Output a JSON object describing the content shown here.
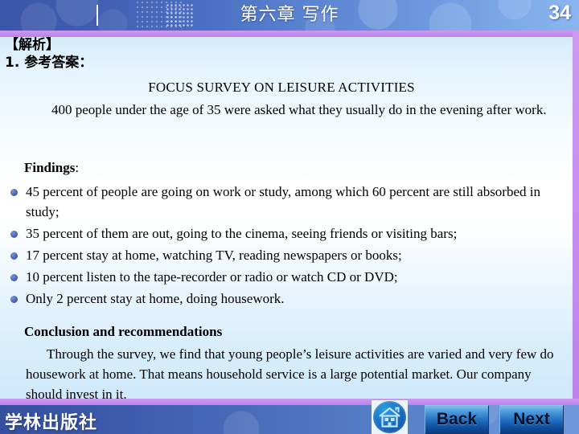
{
  "header": {
    "title": "第六章  写作",
    "page_number": "34"
  },
  "content": {
    "analysis_label": "【解析】",
    "answer_label": "1. 参考答案：",
    "doc_title": "FOCUS SURVEY ON LEISURE ACTIVITIES",
    "intro": "400 people under the age of 35 were asked what they usually do in the evening after work.",
    "findings_label": "Findings",
    "findings_label_suffix": ":",
    "findings": [
      "45 percent of people are going on work or study, among which 60 percent are still absorbed in study;",
      "35 percent of them are out, going to the cinema, seeing friends or visiting bars;",
      "17 percent stay at home, watching TV, reading newspapers or books;",
      "10 percent listen to the tape-recorder or radio or watch CD or DVD;",
      "Only 2 percent stay at home, doing housework."
    ],
    "conclusion_label": "Conclusion and recommendations",
    "conclusion_text": "Through the survey, we find that young people’s leisure activities are varied and very few do housework at home. That means household service is a large potential market. Our company should invest in it."
  },
  "footer": {
    "publisher": "学林出版社",
    "home_icon": "home-icon",
    "back_label": "Back",
    "next_label": "Next"
  },
  "colors": {
    "header_blue_dark": "#3b55a8",
    "header_blue_light": "#8bb6ef",
    "violet_rule": "#c58cf0",
    "bullet_blue": "#4a63bb",
    "content_bg_top": "#d4ecfb",
    "content_bg_mid": "#ffffff",
    "button_blue": "#1f6bbd"
  }
}
